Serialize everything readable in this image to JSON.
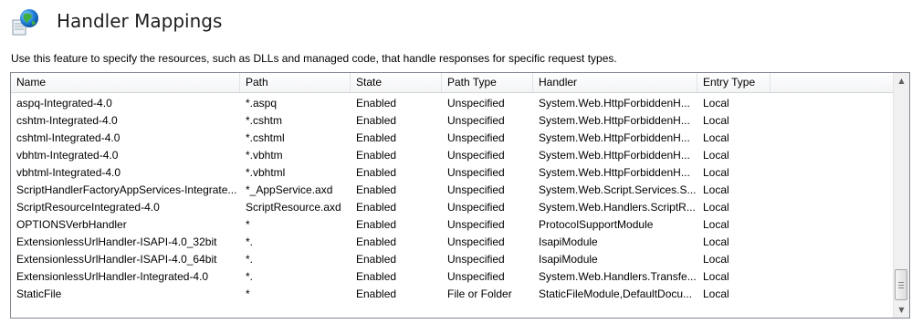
{
  "header": {
    "title": "Handler Mappings",
    "description": "Use this feature to specify the resources, such as DLLs and managed code, that handle responses for specific request types."
  },
  "grid": {
    "columns": [
      "Name",
      "Path",
      "State",
      "Path Type",
      "Handler",
      "Entry Type"
    ],
    "rows": [
      [
        "aspq-Integrated-4.0",
        "*.aspq",
        "Enabled",
        "Unspecified",
        "System.Web.HttpForbiddenH...",
        "Local"
      ],
      [
        "cshtm-Integrated-4.0",
        "*.cshtm",
        "Enabled",
        "Unspecified",
        "System.Web.HttpForbiddenH...",
        "Local"
      ],
      [
        "cshtml-Integrated-4.0",
        "*.cshtml",
        "Enabled",
        "Unspecified",
        "System.Web.HttpForbiddenH...",
        "Local"
      ],
      [
        "vbhtm-Integrated-4.0",
        "*.vbhtm",
        "Enabled",
        "Unspecified",
        "System.Web.HttpForbiddenH...",
        "Local"
      ],
      [
        "vbhtml-Integrated-4.0",
        "*.vbhtml",
        "Enabled",
        "Unspecified",
        "System.Web.HttpForbiddenH...",
        "Local"
      ],
      [
        "ScriptHandlerFactoryAppServices-Integrate...",
        "*_AppService.axd",
        "Enabled",
        "Unspecified",
        "System.Web.Script.Services.S...",
        "Local"
      ],
      [
        "ScriptResourceIntegrated-4.0",
        "ScriptResource.axd",
        "Enabled",
        "Unspecified",
        "System.Web.Handlers.ScriptR...",
        "Local"
      ],
      [
        "OPTIONSVerbHandler",
        "*",
        "Enabled",
        "Unspecified",
        "ProtocolSupportModule",
        "Local"
      ],
      [
        "ExtensionlessUrlHandler-ISAPI-4.0_32bit",
        "*.",
        "Enabled",
        "Unspecified",
        "IsapiModule",
        "Local"
      ],
      [
        "ExtensionlessUrlHandler-ISAPI-4.0_64bit",
        "*.",
        "Enabled",
        "Unspecified",
        "IsapiModule",
        "Local"
      ],
      [
        "ExtensionlessUrlHandler-Integrated-4.0",
        "*.",
        "Enabled",
        "Unspecified",
        "System.Web.Handlers.Transfe...",
        "Local"
      ],
      [
        "StaticFile",
        "*",
        "Enabled",
        "File or Folder",
        "StaticFileModule,DefaultDocu...",
        "Local"
      ]
    ]
  },
  "icons": {
    "header_icon": "globe-icon",
    "scroll_up": "scroll-up-arrow-icon",
    "scroll_down": "scroll-down-arrow-icon"
  }
}
